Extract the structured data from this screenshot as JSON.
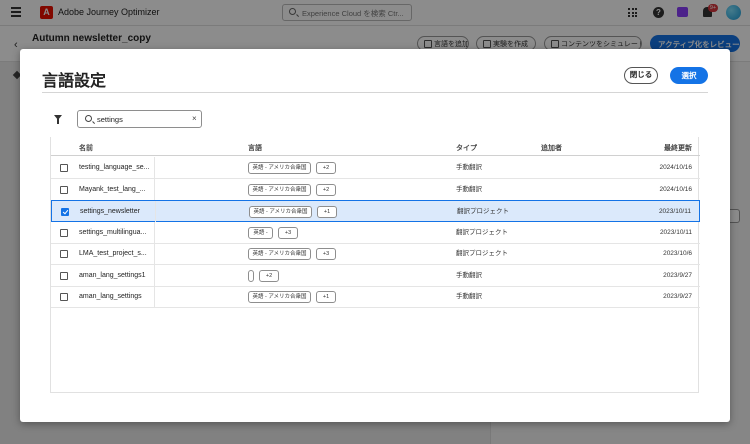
{
  "app": {
    "title": "Adobe Journey Optimizer",
    "logo_letter": "A",
    "search_placeholder": "Experience Cloud を検索 Ctr...",
    "notification_count": "9+"
  },
  "journey": {
    "name": "Autumn newsletter_copy",
    "buttons": [
      "言語を追加",
      "実験を作成",
      "コンテンツをシミュレート"
    ],
    "activate_label": "アクティブ化をレビュー"
  },
  "dialog": {
    "title": "言語設定",
    "close_label": "閉じる",
    "select_label": "選択",
    "search_value": "settings",
    "clear_glyph": "×",
    "columns": {
      "name": "名前",
      "language": "言語",
      "type": "タイプ",
      "added_by": "追加者",
      "last_updated": "最終更新"
    },
    "rows": [
      {
        "name": "testing_language_se...",
        "tag": "英語 - アメリカ合衆国",
        "more": "+2",
        "type": "手動翻訳",
        "date": "2024/10/16",
        "checked": false
      },
      {
        "name": "Mayank_test_lang_...",
        "tag": "英語 - アメリカ合衆国",
        "more": "+2",
        "type": "手動翻訳",
        "date": "2024/10/16",
        "checked": false
      },
      {
        "name": "settings_newsletter",
        "tag": "英語 - アメリカ合衆国",
        "more": "+1",
        "type": "翻訳プロジェクト",
        "date": "2023/10/11",
        "checked": true
      },
      {
        "name": "settings_multilingua...",
        "tag": "英語 -",
        "more": "+3",
        "type": "翻訳プロジェクト",
        "date": "2023/10/11",
        "checked": false
      },
      {
        "name": "LMA_test_project_s...",
        "tag": "英語 - アメリカ合衆国",
        "more": "+3",
        "type": "翻訳プロジェクト",
        "date": "2023/10/6",
        "checked": false
      },
      {
        "name": "aman_lang_settings1",
        "tag": "",
        "more": "+2",
        "type": "手動翻訳",
        "date": "2023/9/27",
        "checked": false
      },
      {
        "name": "aman_lang_settings",
        "tag": "英語 - アメリカ合衆国",
        "more": "+1",
        "type": "手動翻訳",
        "date": "2023/9/27",
        "checked": false
      }
    ]
  },
  "colors": {
    "accent": "#1473e6",
    "selected_row_bg": "#dbe9fb",
    "adobe_red": "#eb1000"
  }
}
